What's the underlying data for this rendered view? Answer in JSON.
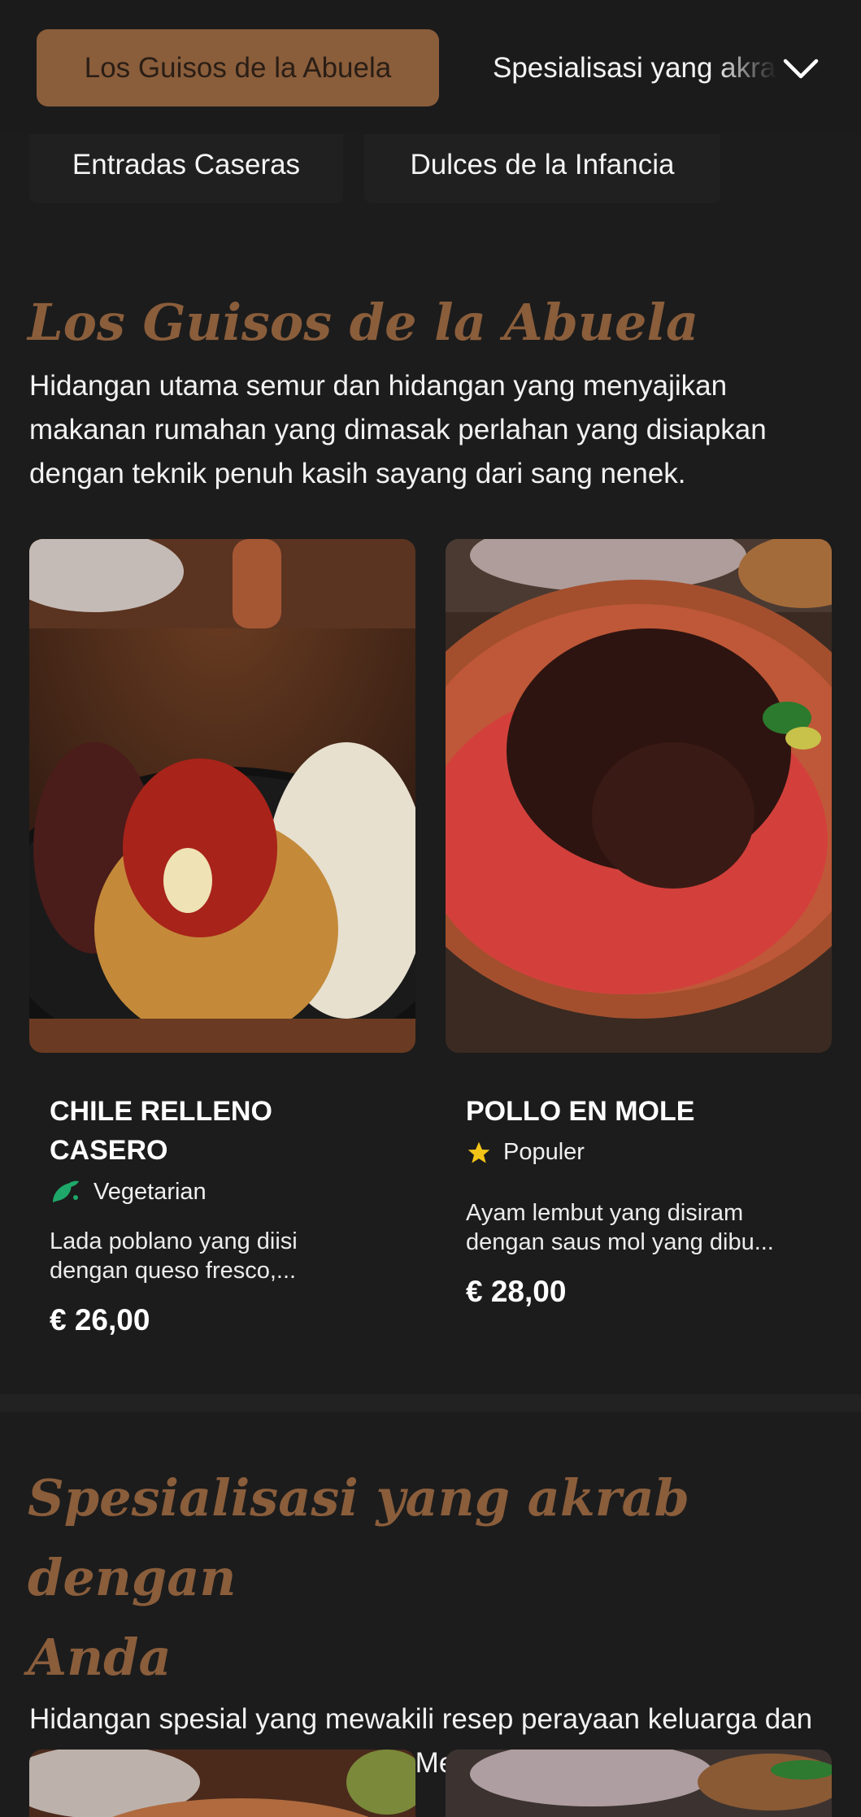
{
  "nav": {
    "active_category": "Los Guisos de la Abuela",
    "next_category": "Spesialisasi yang akrab dengan Anda",
    "sub_categories": [
      "Entradas Caseras",
      "Dulces de la Infancia"
    ]
  },
  "sections": [
    {
      "title": "Los Guisos de la Abuela",
      "description": "Hidangan utama semur dan hidangan yang menyajikan makanan rumahan yang dimasak perlahan yang disiapkan dengan teknik penuh kasih sayang dari sang nenek.",
      "items": [
        {
          "name_line1": "CHILE RELLENO",
          "name_line2": "CASERO",
          "tag": "Vegetarian",
          "desc_line1": "Lada poblano yang diisi",
          "desc_line2": "dengan queso fresco,...",
          "price": "€ 26,00"
        },
        {
          "name_line1": "POLLO EN MOLE",
          "name_line2": "",
          "tag": "Populer",
          "desc_line1": "Ayam lembut yang disiram",
          "desc_line2": "dengan saus mol yang dibu...",
          "price": "€ 28,00"
        }
      ]
    },
    {
      "title_line1": "Spesialisasi yang akrab dengan",
      "title_line2": "Anda",
      "description": "Hidangan spesial yang mewakili resep perayaan keluarga dan masakan warisan dari seluruh Meksiko."
    }
  ],
  "colors": {
    "accent": "#8a5d3b",
    "background": "#1c1c1c",
    "veg": "#1ea86a",
    "star": "#f2c418"
  },
  "icons": [
    "chevron-down-icon",
    "vegetarian-icon",
    "star-icon"
  ]
}
